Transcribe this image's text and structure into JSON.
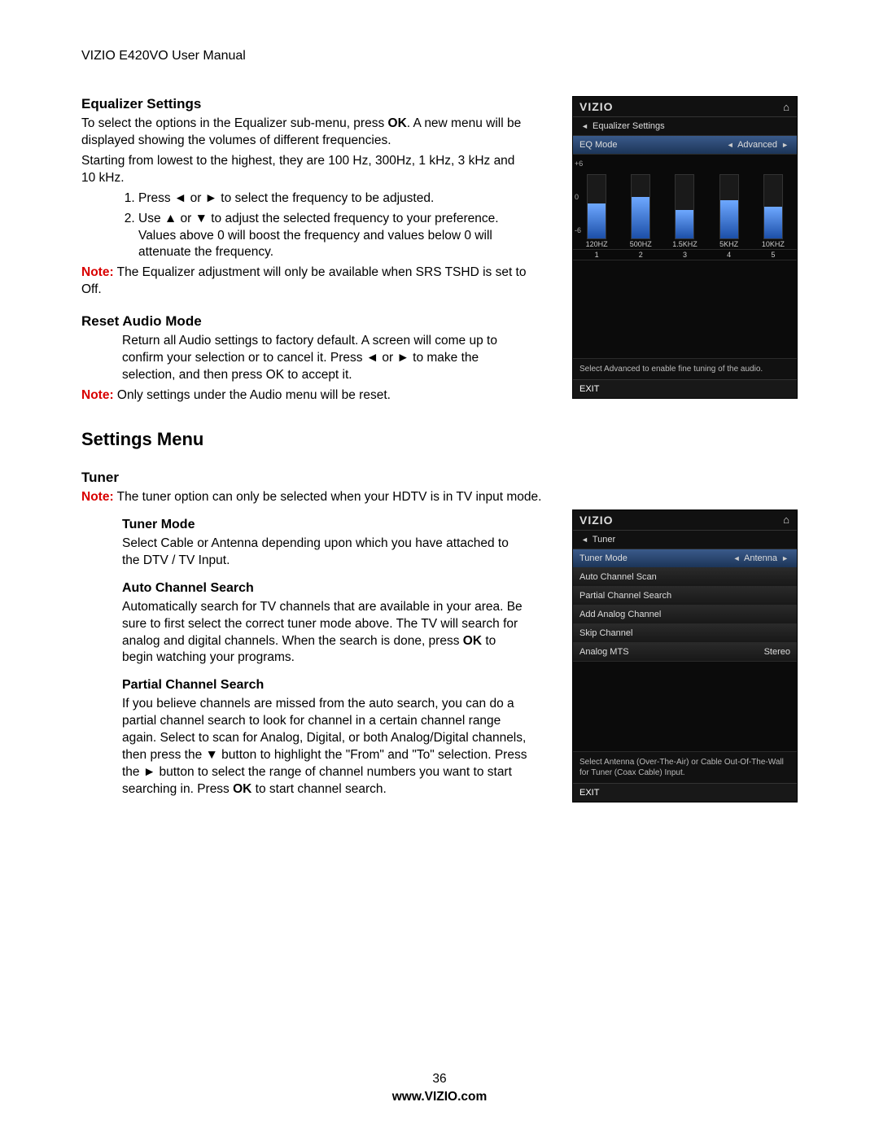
{
  "header": {
    "title": "VIZIO E420VO User Manual"
  },
  "eq": {
    "heading": "Equalizer Settings",
    "p1a": "To select the options in the Equalizer sub-menu, press ",
    "p1b": "OK",
    "p1c": ". A new menu will be displayed showing the volumes of different frequencies.",
    "p2": "Starting from lowest to the highest, they are 100 Hz, 300Hz, 1 kHz, 3 kHz and 10 kHz.",
    "step1": "Press ◄ or ► to select the frequency to be adjusted.",
    "step2": "Use ▲ or ▼ to adjust the selected frequency to your preference. Values above 0 will boost the frequency and values below 0 will attenuate the frequency.",
    "note_label": "Note:",
    "note": " The Equalizer adjustment will only be available when SRS TSHD is set to Off."
  },
  "reset": {
    "heading": "Reset Audio Mode",
    "p": "Return all Audio settings to factory default. A screen will come up to confirm your selection or to cancel it. Press ◄ or ► to make the selection, and then press OK to accept it.",
    "note_label": "Note:",
    "note": " Only settings under the Audio menu will be reset."
  },
  "settings_menu": {
    "heading": "Settings Menu"
  },
  "tuner": {
    "heading": "Tuner",
    "note_label": "Note:",
    "note": " The tuner option can only be selected when your HDTV is in TV input mode.",
    "mode_heading": "Tuner Mode",
    "mode_p": "Select Cable or Antenna depending upon which you have attached to the DTV / TV Input.",
    "auto_heading": "Auto Channel Search",
    "auto_p_a": "Automatically search for TV channels that are available in your area. Be sure to first select the correct tuner mode above. The TV will search for analog and digital channels. When the search is done, press ",
    "auto_p_b": "OK",
    "auto_p_c": " to begin watching your programs.",
    "partial_heading": "Partial Channel Search",
    "partial_p_a": "If you believe channels are missed from the auto search, you can do a partial channel search to look for channel in a certain channel range again. Select to scan for Analog, Digital, or both Analog/Digital channels, then press the ▼ button to highlight the \"From\" and \"To\" selection. Press the ► button to select the range of channel numbers you want to start searching in. Press ",
    "partial_p_b": "OK",
    "partial_p_c": " to start channel search."
  },
  "osd1": {
    "brand": "VIZIO",
    "title": "Equalizer Settings",
    "eq_mode_label": "EQ Mode",
    "eq_mode_value": "Advanced",
    "side": {
      "hi": "+6",
      "mid": "0",
      "lo": "-6"
    },
    "freqs": [
      "120HZ",
      "500HZ",
      "1.5KHZ",
      "5KHZ",
      "10KHZ"
    ],
    "nums": [
      "1",
      "2",
      "3",
      "4",
      "5"
    ],
    "bar_heights_pct": [
      55,
      65,
      45,
      60,
      50
    ],
    "help": "Select Advanced to enable fine tuning of the audio.",
    "exit": "EXIT"
  },
  "osd2": {
    "brand": "VIZIO",
    "title": "Tuner",
    "rows": [
      {
        "label": "Tuner Mode",
        "value": "Antenna",
        "highlight": true,
        "arrows": true
      },
      {
        "label": "Auto Channel Scan"
      },
      {
        "label": "Partial Channel Search"
      },
      {
        "label": "Add Analog Channel"
      },
      {
        "label": "Skip Channel"
      },
      {
        "label": "Analog MTS",
        "value": "Stereo"
      }
    ],
    "help": "Select Antenna (Over-The-Air) or Cable Out-Of-The-Wall for Tuner (Coax Cable) Input.",
    "exit": "EXIT"
  },
  "footer": {
    "page": "36",
    "url": "www.VIZIO.com"
  }
}
